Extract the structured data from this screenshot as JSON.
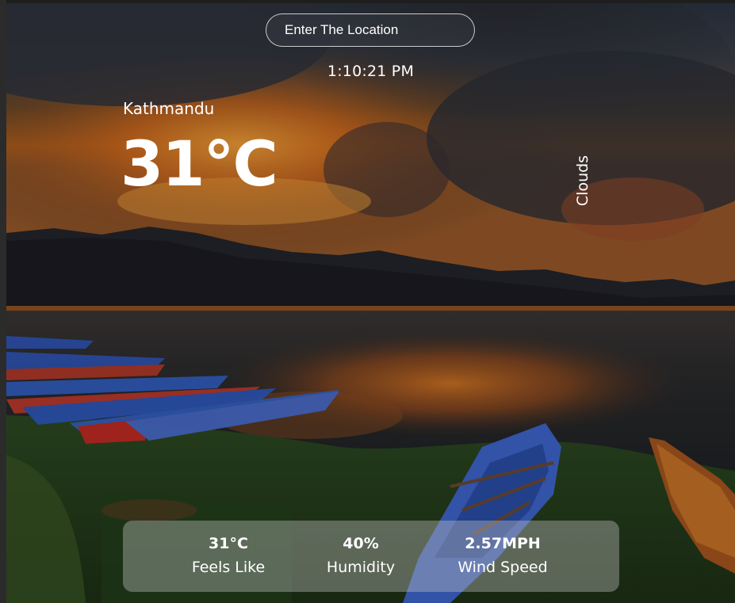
{
  "search": {
    "placeholder": "Enter The Location"
  },
  "time": "1:10:21 PM",
  "weather": {
    "city": "Kathmandu",
    "temperature": "31°C",
    "condition": "Clouds"
  },
  "details": {
    "feels_like": {
      "value": "31°C",
      "label": "Feels Like"
    },
    "humidity": {
      "value": "40%",
      "label": "Humidity"
    },
    "wind_speed": {
      "value": "2.57MPH",
      "label": "Wind Speed"
    }
  },
  "background": {
    "description_icon": "lake-sunset-boats-photo"
  }
}
